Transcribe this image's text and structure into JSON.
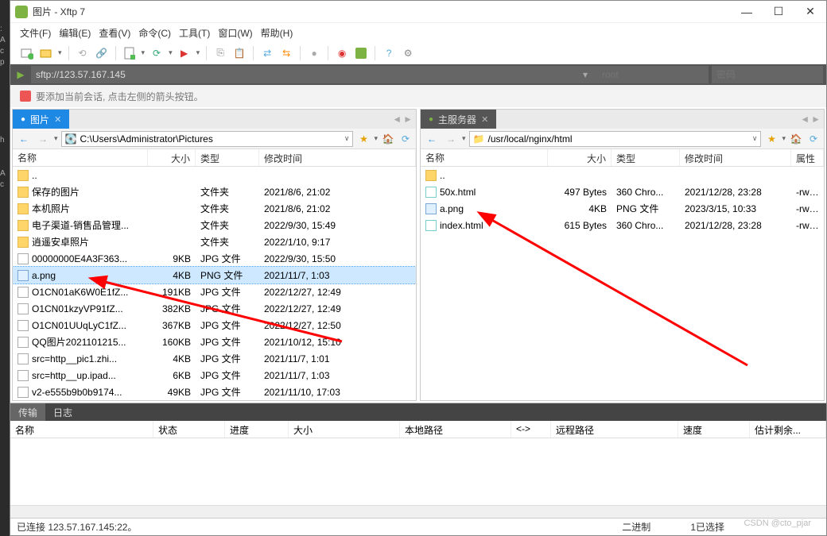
{
  "window": {
    "title": "图片 - Xftp 7"
  },
  "menu": {
    "file": "文件(F)",
    "edit": "编辑(E)",
    "view": "查看(V)",
    "cmd": "命令(C)",
    "tool": "工具(T)",
    "win": "窗口(W)",
    "help": "帮助(H)"
  },
  "address": {
    "url": "sftp://123.57.167.145",
    "user_ph": "root",
    "pass_ph": "密码"
  },
  "hint": "要添加当前会话, 点击左侧的箭头按钮。",
  "left": {
    "tab": "图片",
    "path": "C:\\Users\\Administrator\\Pictures",
    "cols": {
      "name": "名称",
      "size": "大小",
      "type": "类型",
      "mod": "修改时间"
    },
    "rows": [
      {
        "name": "..",
        "size": "",
        "type": "",
        "mod": "",
        "icon": "folder"
      },
      {
        "name": "..",
        "size": "",
        "type": "文件夹",
        "mod": "",
        "icon": "folder-up",
        "hide": true
      },
      {
        "name": "保存的图片",
        "size": "",
        "type": "文件夹",
        "mod": "2021/8/6, 21:02",
        "icon": "folder"
      },
      {
        "name": "本机照片",
        "size": "",
        "type": "文件夹",
        "mod": "2021/8/6, 21:02",
        "icon": "folder"
      },
      {
        "name": "电子渠道-销售品管理...",
        "size": "",
        "type": "文件夹",
        "mod": "2022/9/30, 15:49",
        "icon": "folder"
      },
      {
        "name": "逍遥安卓照片",
        "size": "",
        "type": "文件夹",
        "mod": "2022/1/10, 9:17",
        "icon": "folder"
      },
      {
        "name": "00000000E4A3F363...",
        "size": "9KB",
        "type": "JPG 文件",
        "mod": "2022/9/30, 15:50",
        "icon": "file"
      },
      {
        "name": "a.png",
        "size": "4KB",
        "type": "PNG 文件",
        "mod": "2021/11/7, 1:03",
        "icon": "png",
        "selected": true
      },
      {
        "name": "O1CN01aK6W0E1fZ...",
        "size": "191KB",
        "type": "JPG 文件",
        "mod": "2022/12/27, 12:49",
        "icon": "file"
      },
      {
        "name": "O1CN01kzyVP91fZ...",
        "size": "382KB",
        "type": "JPG 文件",
        "mod": "2022/12/27, 12:49",
        "icon": "file"
      },
      {
        "name": "O1CN01UUqLyC1fZ...",
        "size": "367KB",
        "type": "JPG 文件",
        "mod": "2022/12/27, 12:50",
        "icon": "file"
      },
      {
        "name": "QQ图片2021101215...",
        "size": "160KB",
        "type": "JPG 文件",
        "mod": "2021/10/12, 15:10",
        "icon": "file"
      },
      {
        "name": "src=http__pic1.zhi...",
        "size": "4KB",
        "type": "JPG 文件",
        "mod": "2021/11/7, 1:01",
        "icon": "file"
      },
      {
        "name": "src=http__up.ipad...",
        "size": "6KB",
        "type": "JPG 文件",
        "mod": "2021/11/7, 1:03",
        "icon": "file"
      },
      {
        "name": "v2-e555b9b0b9174...",
        "size": "49KB",
        "type": "JPG 文件",
        "mod": "2021/11/10, 17:03",
        "icon": "file"
      }
    ]
  },
  "right": {
    "tab": "主服务器",
    "path": "/usr/local/nginx/html",
    "cols": {
      "name": "名称",
      "size": "大小",
      "type": "类型",
      "mod": "修改时间",
      "attr": "属性"
    },
    "rows": [
      {
        "name": "..",
        "size": "",
        "type": "",
        "mod": "",
        "attr": "",
        "icon": "folder"
      },
      {
        "name": "50x.html",
        "size": "497 Bytes",
        "type": "360 Chro...",
        "mod": "2021/12/28, 23:28",
        "attr": "-rw-r--r--",
        "icon": "html"
      },
      {
        "name": "a.png",
        "size": "4KB",
        "type": "PNG 文件",
        "mod": "2023/3/15, 10:33",
        "attr": "-rw-r--r--",
        "icon": "png"
      },
      {
        "name": "index.html",
        "size": "615 Bytes",
        "type": "360 Chro...",
        "mod": "2021/12/28, 23:28",
        "attr": "-rw-r--r--",
        "icon": "html"
      }
    ]
  },
  "bottom": {
    "tabs": {
      "transfer": "传输",
      "log": "日志"
    },
    "cols": {
      "name": "名称",
      "status": "状态",
      "progress": "进度",
      "size": "大小",
      "local": "本地路径",
      "dir": "<->",
      "remote": "远程路径",
      "speed": "速度",
      "eta": "估计剩余..."
    }
  },
  "status": {
    "conn": "已连接 123.57.167.145:22。",
    "bin": "二进制",
    "sel": "1已选择"
  },
  "watermark": "CSDN @cto_pjar"
}
